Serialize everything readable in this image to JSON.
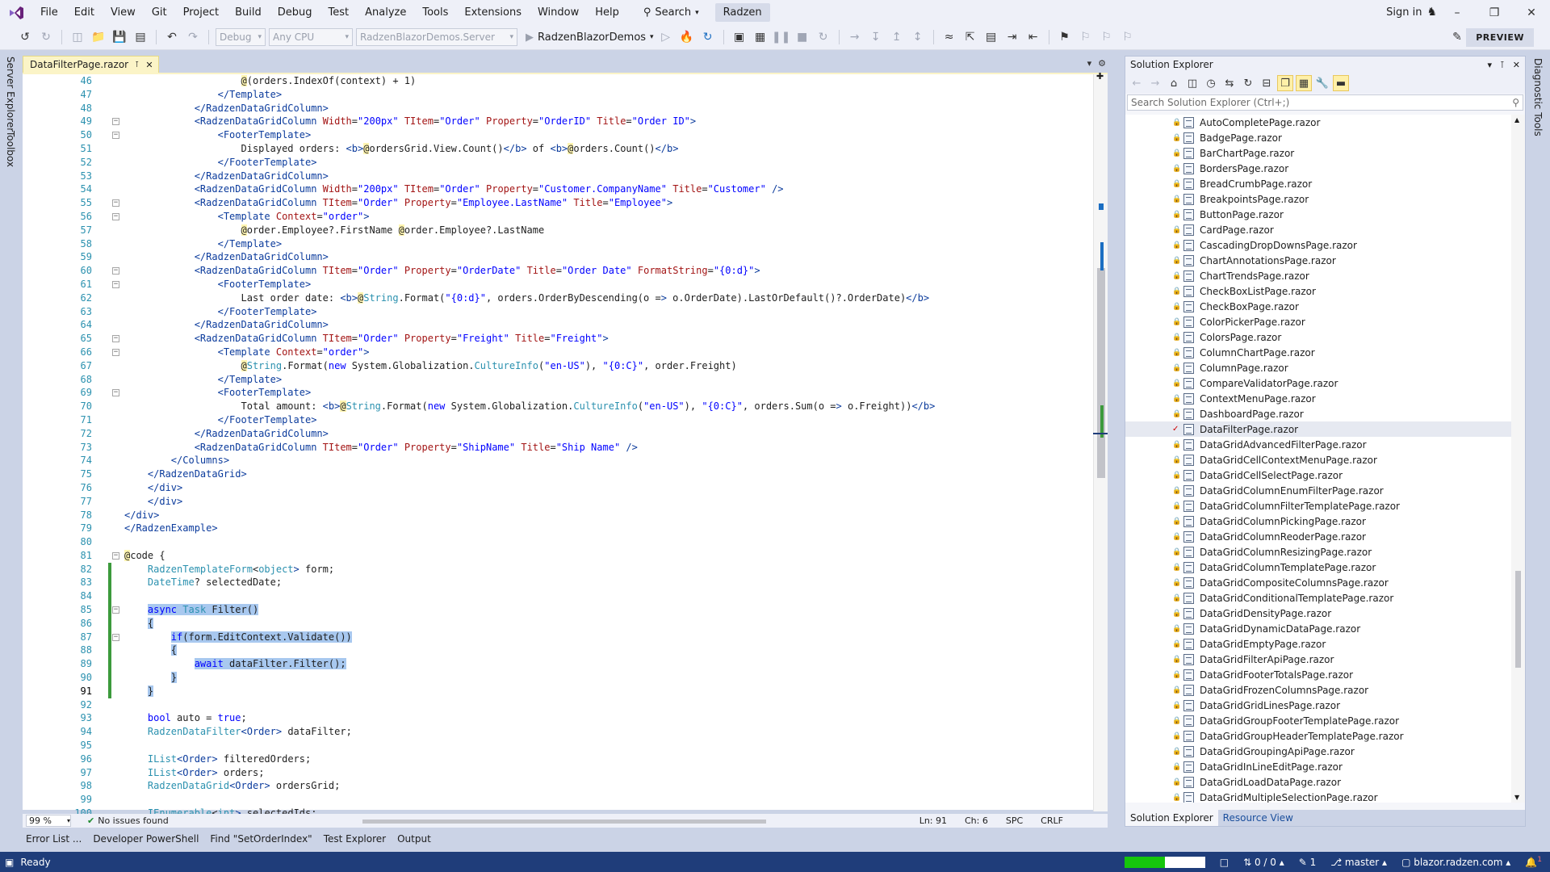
{
  "menu": {
    "items": [
      "File",
      "Edit",
      "View",
      "Git",
      "Project",
      "Build",
      "Debug",
      "Test",
      "Analyze",
      "Tools",
      "Extensions",
      "Window",
      "Help"
    ],
    "search_label": "Search",
    "solution_name": "Radzen",
    "signin_label": "Sign in"
  },
  "toolbar": {
    "config": "Debug",
    "platform": "Any CPU",
    "startup_project": "RadzenBlazorDemos.Server",
    "run_target": "RadzenBlazorDemos",
    "preview_label": "PREVIEW"
  },
  "side_tabs": {
    "left": [
      "Server Explorer",
      "Toolbox"
    ],
    "right": [
      "Diagnostic Tools"
    ]
  },
  "editor": {
    "tab_title": "DataFilterPage.razor",
    "current_line": 91,
    "lines": [
      {
        "n": 46,
        "t": "                    @(orders.IndexOf(context) + 1)"
      },
      {
        "n": 47,
        "t": "                </Template>"
      },
      {
        "n": 48,
        "t": "            </RadzenDataGridColumn>"
      },
      {
        "n": 49,
        "t": "            <RadzenDataGridColumn Width=\"200px\" TItem=\"Order\" Property=\"OrderID\" Title=\"Order ID\">",
        "fold": true
      },
      {
        "n": 50,
        "t": "                <FooterTemplate>",
        "fold": true
      },
      {
        "n": 51,
        "t": "                    Displayed orders: <b>@ordersGrid.View.Count()</b> of <b>@orders.Count()</b>"
      },
      {
        "n": 52,
        "t": "                </FooterTemplate>"
      },
      {
        "n": 53,
        "t": "            </RadzenDataGridColumn>"
      },
      {
        "n": 54,
        "t": "            <RadzenDataGridColumn Width=\"200px\" TItem=\"Order\" Property=\"Customer.CompanyName\" Title=\"Customer\" />"
      },
      {
        "n": 55,
        "t": "            <RadzenDataGridColumn TItem=\"Order\" Property=\"Employee.LastName\" Title=\"Employee\">",
        "fold": true
      },
      {
        "n": 56,
        "t": "                <Template Context=\"order\">",
        "fold": true
      },
      {
        "n": 57,
        "t": "                    @order.Employee?.FirstName @order.Employee?.LastName"
      },
      {
        "n": 58,
        "t": "                </Template>"
      },
      {
        "n": 59,
        "t": "            </RadzenDataGridColumn>"
      },
      {
        "n": 60,
        "t": "            <RadzenDataGridColumn TItem=\"Order\" Property=\"OrderDate\" Title=\"Order Date\" FormatString=\"{0:d}\">",
        "fold": true
      },
      {
        "n": 61,
        "t": "                <FooterTemplate>",
        "fold": true
      },
      {
        "n": 62,
        "t": "                    Last order date: <b>@String.Format(\"{0:d}\", orders.OrderByDescending(o => o.OrderDate).LastOrDefault()?.OrderDate)</b>"
      },
      {
        "n": 63,
        "t": "                </FooterTemplate>"
      },
      {
        "n": 64,
        "t": "            </RadzenDataGridColumn>"
      },
      {
        "n": 65,
        "t": "            <RadzenDataGridColumn TItem=\"Order\" Property=\"Freight\" Title=\"Freight\">",
        "fold": true
      },
      {
        "n": 66,
        "t": "                <Template Context=\"order\">",
        "fold": true
      },
      {
        "n": 67,
        "t": "                    @String.Format(new System.Globalization.CultureInfo(\"en-US\"), \"{0:C}\", order.Freight)"
      },
      {
        "n": 68,
        "t": "                </Template>"
      },
      {
        "n": 69,
        "t": "                <FooterTemplate>",
        "fold": true
      },
      {
        "n": 70,
        "t": "                    Total amount: <b>@String.Format(new System.Globalization.CultureInfo(\"en-US\"), \"{0:C}\", orders.Sum(o => o.Freight))</b>"
      },
      {
        "n": 71,
        "t": "                </FooterTemplate>"
      },
      {
        "n": 72,
        "t": "            </RadzenDataGridColumn>"
      },
      {
        "n": 73,
        "t": "            <RadzenDataGridColumn TItem=\"Order\" Property=\"ShipName\" Title=\"Ship Name\" />"
      },
      {
        "n": 74,
        "t": "        </Columns>"
      },
      {
        "n": 75,
        "t": "    </RadzenDataGrid>"
      },
      {
        "n": 76,
        "t": "    </div>"
      },
      {
        "n": 77,
        "t": "    </div>"
      },
      {
        "n": 78,
        "t": "</div>"
      },
      {
        "n": 79,
        "t": "</RadzenExample>"
      },
      {
        "n": 80,
        "t": ""
      },
      {
        "n": 81,
        "t": "@code {",
        "fold": true
      },
      {
        "n": 82,
        "t": "    RadzenTemplateForm<object> form;",
        "chg": true
      },
      {
        "n": 83,
        "t": "    DateTime? selectedDate;",
        "chg": true
      },
      {
        "n": 84,
        "t": "",
        "chg": true
      },
      {
        "n": 85,
        "t": "    async Task Filter()",
        "fold": true,
        "chg": true,
        "sel": true
      },
      {
        "n": 86,
        "t": "    {",
        "chg": true,
        "sel": true
      },
      {
        "n": 87,
        "t": "        if(form.EditContext.Validate())",
        "fold": true,
        "chg": true,
        "sel": true
      },
      {
        "n": 88,
        "t": "        {",
        "chg": true,
        "sel": true
      },
      {
        "n": 89,
        "t": "            await dataFilter.Filter();",
        "chg": true,
        "sel": true
      },
      {
        "n": 90,
        "t": "        }",
        "chg": true,
        "sel": true
      },
      {
        "n": 91,
        "t": "    }",
        "chg": true,
        "sel": true
      },
      {
        "n": 92,
        "t": ""
      },
      {
        "n": 93,
        "t": "    bool auto = true;"
      },
      {
        "n": 94,
        "t": "    RadzenDataFilter<Order> dataFilter;"
      },
      {
        "n": 95,
        "t": ""
      },
      {
        "n": 96,
        "t": "    IList<Order> filteredOrders;"
      },
      {
        "n": 97,
        "t": "    IList<Order> orders;"
      },
      {
        "n": 98,
        "t": "    RadzenDataGrid<Order> ordersGrid;"
      },
      {
        "n": 99,
        "t": ""
      },
      {
        "n": 100,
        "t": "    IEnumerable<int> selectedIds;"
      }
    ]
  },
  "editor_status": {
    "zoom": "99 %",
    "issues": "No issues found",
    "line": "Ln: 91",
    "col": "Ch: 6",
    "whitespace": "SPC",
    "line_ending": "CRLF"
  },
  "bottom_tabs": [
    "Error List ...",
    "Developer PowerShell",
    "Find \"SetOrderIndex\"",
    "Test Explorer",
    "Output"
  ],
  "solution_explorer": {
    "title": "Solution Explorer",
    "search_placeholder": "Search Solution Explorer (Ctrl+;)",
    "selected": "DataFilterPage.razor",
    "files": [
      "AutoCompletePage.razor",
      "BadgePage.razor",
      "BarChartPage.razor",
      "BordersPage.razor",
      "BreadCrumbPage.razor",
      "BreakpointsPage.razor",
      "ButtonPage.razor",
      "CardPage.razor",
      "CascadingDropDownsPage.razor",
      "ChartAnnotationsPage.razor",
      "ChartTrendsPage.razor",
      "CheckBoxListPage.razor",
      "CheckBoxPage.razor",
      "ColorPickerPage.razor",
      "ColorsPage.razor",
      "ColumnChartPage.razor",
      "ColumnPage.razor",
      "CompareValidatorPage.razor",
      "ContextMenuPage.razor",
      "DashboardPage.razor",
      "DataFilterPage.razor",
      "DataGridAdvancedFilterPage.razor",
      "DataGridCellContextMenuPage.razor",
      "DataGridCellSelectPage.razor",
      "DataGridColumnEnumFilterPage.razor",
      "DataGridColumnFilterTemplatePage.razor",
      "DataGridColumnPickingPage.razor",
      "DataGridColumnReoderPage.razor",
      "DataGridColumnResizingPage.razor",
      "DataGridColumnTemplatePage.razor",
      "DataGridCompositeColumnsPage.razor",
      "DataGridConditionalTemplatePage.razor",
      "DataGridDensityPage.razor",
      "DataGridDynamicDataPage.razor",
      "DataGridEmptyPage.razor",
      "DataGridFilterApiPage.razor",
      "DataGridFooterTotalsPage.razor",
      "DataGridFrozenColumnsPage.razor",
      "DataGridGridLinesPage.razor",
      "DataGridGroupFooterTemplatePage.razor",
      "DataGridGroupHeaderTemplatePage.razor",
      "DataGridGroupingApiPage.razor",
      "DataGridInLineEditPage.razor",
      "DataGridLoadDataPage.razor",
      "DataGridMultipleSelectionPage.razor"
    ],
    "bottom_tabs": [
      "Solution Explorer",
      "Resource View"
    ]
  },
  "statusbar": {
    "ready": "Ready",
    "progress": 0.5,
    "sync": "0 / 0",
    "pencil_count": "1",
    "branch": "master",
    "repo": "blazor.radzen.com",
    "notifications": "1"
  },
  "colors": {
    "accent": "#1f3d7a",
    "selection": "#a8c8ef",
    "changed": "#3c9a3c",
    "tab_active": "#fbf4c7"
  }
}
